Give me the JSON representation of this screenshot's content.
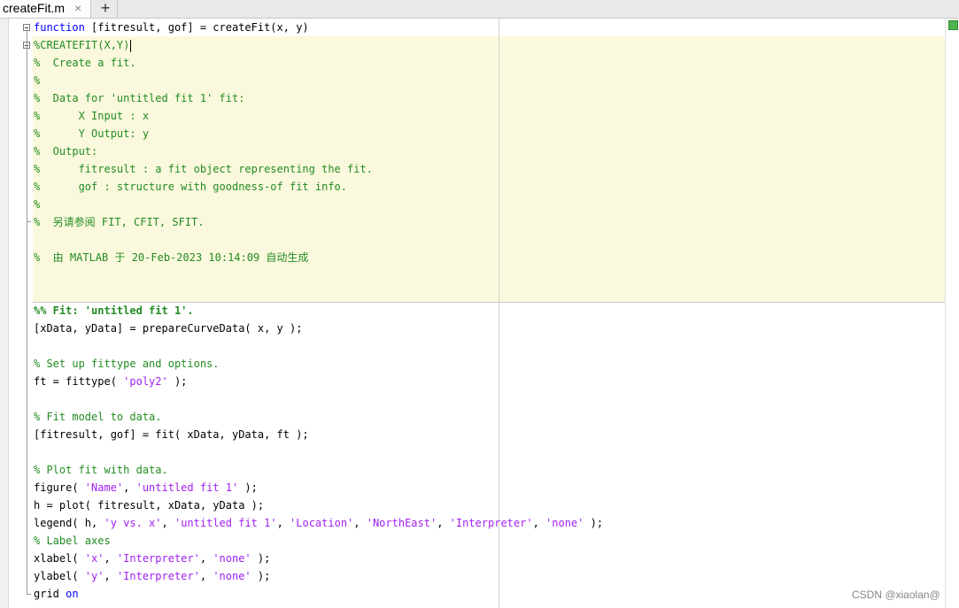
{
  "tab": {
    "filename": "createFit.m",
    "close_glyph": "×",
    "new_tab_glyph": "+"
  },
  "code_lines": [
    [
      {
        "t": "kw",
        "v": "function"
      },
      {
        "t": "n",
        "v": " [fitresult, gof] = createFit(x, y)"
      }
    ],
    [
      {
        "t": "cm",
        "v": "%CREATEFIT(X,Y)"
      }
    ],
    [
      {
        "t": "cm",
        "v": "%  Create a fit."
      }
    ],
    [
      {
        "t": "cm",
        "v": "%"
      }
    ],
    [
      {
        "t": "cm",
        "v": "%  Data for 'untitled fit 1' fit:"
      }
    ],
    [
      {
        "t": "cm",
        "v": "%      X Input : x"
      }
    ],
    [
      {
        "t": "cm",
        "v": "%      Y Output: y"
      }
    ],
    [
      {
        "t": "cm",
        "v": "%  Output:"
      }
    ],
    [
      {
        "t": "cm",
        "v": "%      fitresult : a fit object representing the fit."
      }
    ],
    [
      {
        "t": "cm",
        "v": "%      gof : structure with goodness-of fit info."
      }
    ],
    [
      {
        "t": "cm",
        "v": "%"
      }
    ],
    [
      {
        "t": "cm",
        "v": "%  另请参阅 FIT, CFIT, SFIT."
      }
    ],
    [],
    [
      {
        "t": "cm",
        "v": "%  由 MATLAB 于 20-Feb-2023 10:14:09 自动生成"
      }
    ],
    [],
    [],
    [
      {
        "t": "hdr",
        "v": "%% Fit: 'untitled fit 1'."
      }
    ],
    [
      {
        "t": "n",
        "v": "[xData, yData] = prepareCurveData( x, y );"
      }
    ],
    [],
    [
      {
        "t": "cm",
        "v": "% Set up fittype and options."
      }
    ],
    [
      {
        "t": "n",
        "v": "ft = fittype( "
      },
      {
        "t": "str",
        "v": "'poly2'"
      },
      {
        "t": "n",
        "v": " );"
      }
    ],
    [],
    [
      {
        "t": "cm",
        "v": "% Fit model to data."
      }
    ],
    [
      {
        "t": "n",
        "v": "[fitresult, gof] = fit( xData, yData, ft );"
      }
    ],
    [],
    [
      {
        "t": "cm",
        "v": "% Plot fit with data."
      }
    ],
    [
      {
        "t": "n",
        "v": "figure( "
      },
      {
        "t": "str",
        "v": "'Name'"
      },
      {
        "t": "n",
        "v": ", "
      },
      {
        "t": "str",
        "v": "'untitled fit 1'"
      },
      {
        "t": "n",
        "v": " );"
      }
    ],
    [
      {
        "t": "n",
        "v": "h = plot( fitresult, xData, yData );"
      }
    ],
    [
      {
        "t": "n",
        "v": "legend( h, "
      },
      {
        "t": "str",
        "v": "'y vs. x'"
      },
      {
        "t": "n",
        "v": ", "
      },
      {
        "t": "str",
        "v": "'untitled fit 1'"
      },
      {
        "t": "n",
        "v": ", "
      },
      {
        "t": "str",
        "v": "'Location'"
      },
      {
        "t": "n",
        "v": ", "
      },
      {
        "t": "str",
        "v": "'NorthEast'"
      },
      {
        "t": "n",
        "v": ", "
      },
      {
        "t": "str",
        "v": "'Interpreter'"
      },
      {
        "t": "n",
        "v": ", "
      },
      {
        "t": "str",
        "v": "'none'"
      },
      {
        "t": "n",
        "v": " );"
      }
    ],
    [
      {
        "t": "cm",
        "v": "% Label axes"
      }
    ],
    [
      {
        "t": "n",
        "v": "xlabel( "
      },
      {
        "t": "str",
        "v": "'x'"
      },
      {
        "t": "n",
        "v": ", "
      },
      {
        "t": "str",
        "v": "'Interpreter'"
      },
      {
        "t": "n",
        "v": ", "
      },
      {
        "t": "str",
        "v": "'none'"
      },
      {
        "t": "n",
        "v": " );"
      }
    ],
    [
      {
        "t": "n",
        "v": "ylabel( "
      },
      {
        "t": "str",
        "v": "'y'"
      },
      {
        "t": "n",
        "v": ", "
      },
      {
        "t": "str",
        "v": "'Interpreter'"
      },
      {
        "t": "n",
        "v": ", "
      },
      {
        "t": "str",
        "v": "'none'"
      },
      {
        "t": "n",
        "v": " );"
      }
    ],
    [
      {
        "t": "n",
        "v": "grid "
      },
      {
        "t": "kw",
        "v": "on"
      }
    ]
  ],
  "watermark": "CSDN @xiaolan@",
  "colors": {
    "keyword": "#0000ff",
    "comment": "#228b22",
    "string": "#a020f0",
    "cell_background": "#fbf9dd"
  }
}
